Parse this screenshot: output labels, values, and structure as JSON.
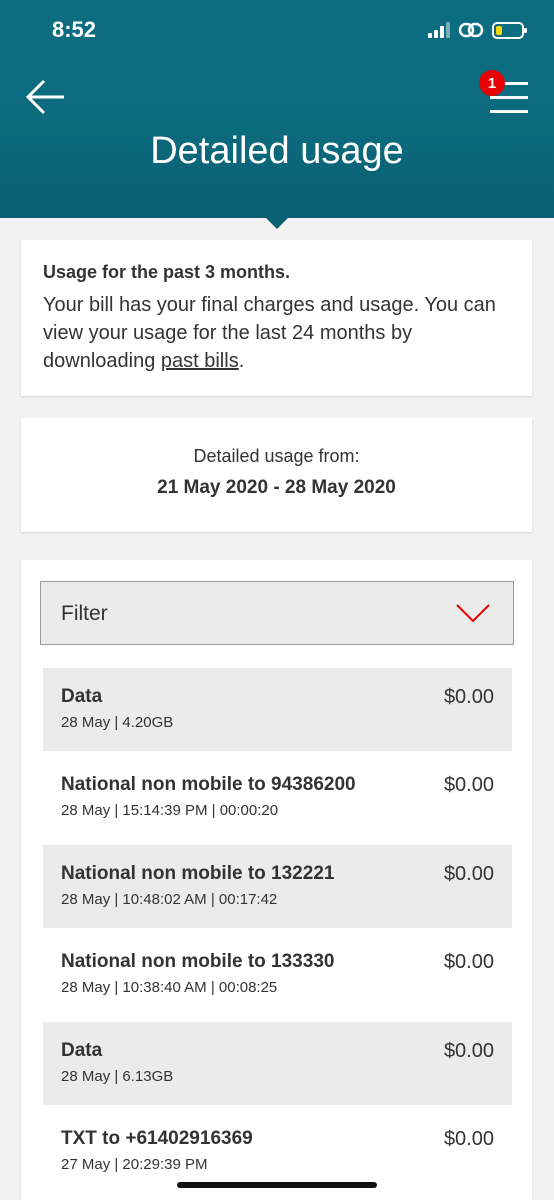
{
  "status_bar": {
    "time": "8:52"
  },
  "header": {
    "title": "Detailed usage",
    "menu_badge": "1"
  },
  "info_card": {
    "title": "Usage for the past 3 months.",
    "text_before_link": "Your bill has your final charges and usage. You can view your usage for the last 24 months by downloading ",
    "link_text": "past bills",
    "text_after_link": "."
  },
  "range_card": {
    "label": "Detailed usage from:",
    "value": "21 May 2020 - 28 May 2020"
  },
  "filter": {
    "label": "Filter"
  },
  "usage_rows": [
    {
      "title": "Data",
      "sub": "28 May | 4.20GB",
      "amount": "$0.00"
    },
    {
      "title": "National non mobile to 94386200",
      "sub": "28 May | 15:14:39 PM | 00:00:20",
      "amount": "$0.00"
    },
    {
      "title": "National non mobile to 132221",
      "sub": "28 May | 10:48:02 AM | 00:17:42",
      "amount": "$0.00"
    },
    {
      "title": "National non mobile to 133330",
      "sub": "28 May | 10:38:40 AM | 00:08:25",
      "amount": "$0.00"
    },
    {
      "title": "Data",
      "sub": "28 May | 6.13GB",
      "amount": "$0.00"
    },
    {
      "title": "TXT to +61402916369",
      "sub": "27 May | 20:29:39 PM",
      "amount": "$0.00"
    }
  ],
  "colors": {
    "header": "#0c6a7d",
    "accent_red": "#e60000",
    "row_shade": "#ebebeb"
  },
  "icons": {
    "back": "arrow-left-icon",
    "menu": "hamburger-menu-icon",
    "filter": "chevron-down-icon",
    "signal": "cellular-signal-icon",
    "link": "link-icon",
    "battery": "battery-icon"
  }
}
